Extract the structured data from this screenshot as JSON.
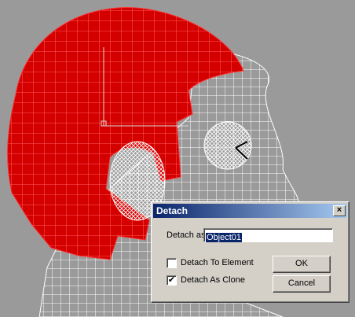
{
  "dialog": {
    "title": "Detach",
    "close_glyph": "×",
    "detach_as_label": "Detach as:",
    "detach_as_value": "Object01",
    "options": [
      {
        "label": "Detach To Element",
        "checked": false
      },
      {
        "label": "Detach As Clone",
        "checked": true
      }
    ],
    "ok_label": "OK",
    "cancel_label": "Cancel",
    "check_glyph": "✔"
  },
  "colors": {
    "viewport_bg": "#9a9a9a",
    "selected_faces": "#d40000",
    "wire": "#ffffff",
    "title_bar": "#0a246a"
  }
}
